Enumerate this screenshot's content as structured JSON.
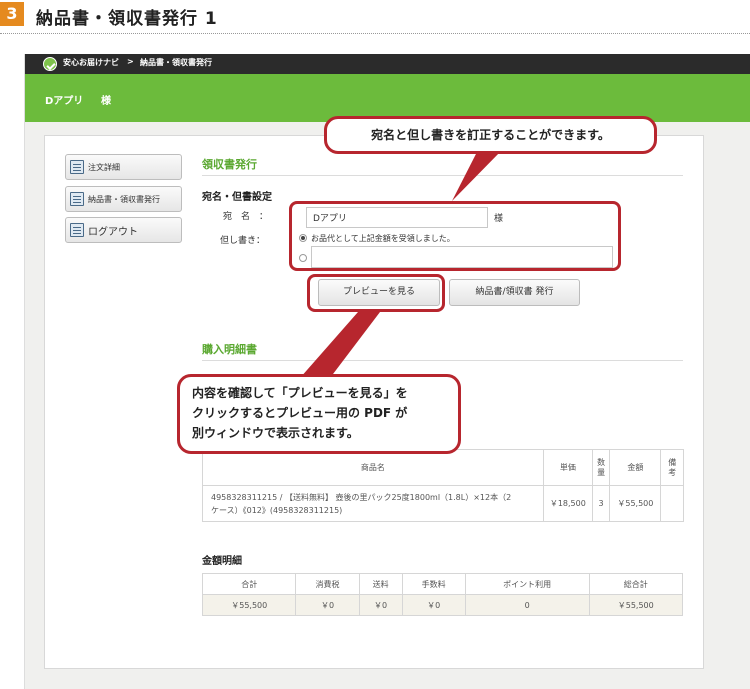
{
  "heading": {
    "step_number": "3",
    "title": "納品書・領収書発行 1"
  },
  "colors": {
    "accent_green": "#6cbb3c",
    "title_green": "#5aa830",
    "callout_red": "#b7262e",
    "step_orange": "#e58a1f"
  },
  "breadcrumb": {
    "home": "安心お届けナビ",
    "separator": ">",
    "current": "納品書・領収書発行"
  },
  "user": {
    "name": "Dアプリ",
    "suffix": "様"
  },
  "sidebar": {
    "items": [
      {
        "label": "注文詳細",
        "icon": "document-icon"
      },
      {
        "label": "納品書・領収書発行",
        "icon": "document-icon"
      },
      {
        "label": "ログアウト",
        "icon": "logout-icon"
      }
    ]
  },
  "receipt": {
    "section_title": "領収書発行",
    "settings_title": "宛名・但書設定",
    "addressee_label": "宛　名　：",
    "addressee_value": "Dアプリ",
    "addressee_suffix": "様",
    "note_label": "但し書き：",
    "note_option_default": "お品代として上記金額を受領しました。",
    "note_custom_value": "",
    "preview_button": "プレビューを見る",
    "issue_button": "納品書/領収書 発行"
  },
  "purchase": {
    "section_title": "購入明細書",
    "columns": [
      "商品名",
      "単価",
      "数量",
      "金額",
      "備考"
    ],
    "rows": [
      {
        "name_line1": "4958328311215 / 【送料無料】 壺後の里パック25度1800ml（1.8L）×12本（2",
        "name_line2": "ケース）《012》(4958328311215)",
        "price": "￥18,500",
        "qty": "3",
        "amount": "￥55,500",
        "note": ""
      }
    ]
  },
  "summary": {
    "title": "金額明細",
    "columns": [
      "合計",
      "消費税",
      "送料",
      "手数料",
      "ポイント利用",
      "総合計"
    ],
    "values": [
      "￥55,500",
      "￥0",
      "￥0",
      "￥0",
      "0",
      "￥55,500"
    ]
  },
  "callouts": {
    "top": "宛名と但し書きを訂正することができます。",
    "bottom_line1": "内容を確認して「プレビューを見る」を",
    "bottom_line2": "クリックするとプレビュー用の PDF が",
    "bottom_line3": "別ウィンドウで表示されます。"
  }
}
